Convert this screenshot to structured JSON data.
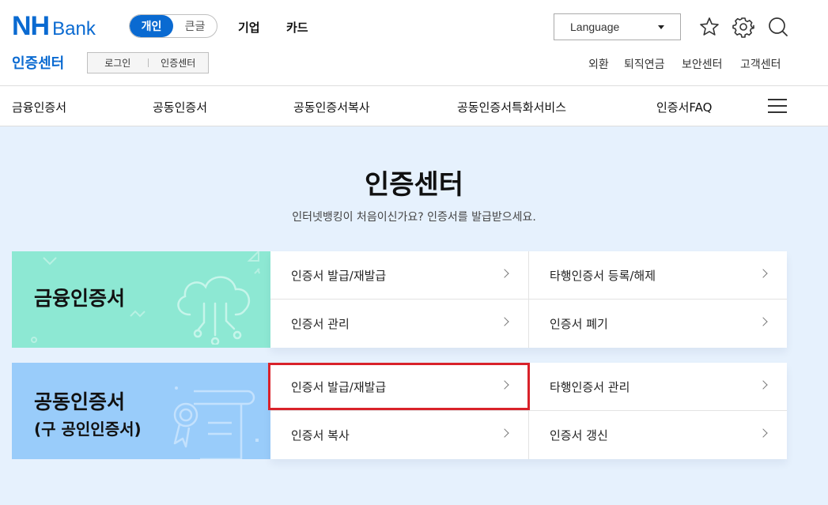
{
  "header": {
    "logo_nh": "NH",
    "logo_bank": "Bank",
    "segments": [
      "개인",
      "큰글"
    ],
    "topnav": [
      "기업",
      "카드"
    ],
    "language_label": "Language",
    "subbrand": "인증센터",
    "subbuttons": [
      "로그인",
      "인증센터"
    ],
    "util_links": [
      "외환",
      "퇴직연금",
      "보안센터",
      "고객센터"
    ]
  },
  "gnb": {
    "items": [
      "금융인증서",
      "공동인증서",
      "공동인증서복사",
      "공동인증서특화서비스",
      "인증서FAQ"
    ]
  },
  "main": {
    "title": "인증센터",
    "subtitle": "인터넷뱅킹이 처음이신가요? 인증서를 발급받으세요."
  },
  "categories": [
    {
      "title": "금융인증서",
      "bg": "#8de8d3",
      "links": [
        "인증서 발급/재발급",
        "타행인증서 등록/해제",
        "인증서 관리",
        "인증서 폐기"
      ]
    },
    {
      "title": "공동인증서",
      "subtitle": "(구 공인인증서)",
      "bg": "#99ccfa",
      "links": [
        "인증서 발급/재발급",
        "타행인증서 관리",
        "인증서 복사",
        "인증서 갱신"
      ]
    }
  ],
  "colors": {
    "brand": "#0a6ad1",
    "highlight": "#d9222a",
    "page_bg": "#e6f1fd"
  },
  "icons": [
    "star-icon",
    "gear-icon",
    "search-icon",
    "menu-icon",
    "chevron-right-icon",
    "cloud-icon",
    "certificate-icon"
  ]
}
